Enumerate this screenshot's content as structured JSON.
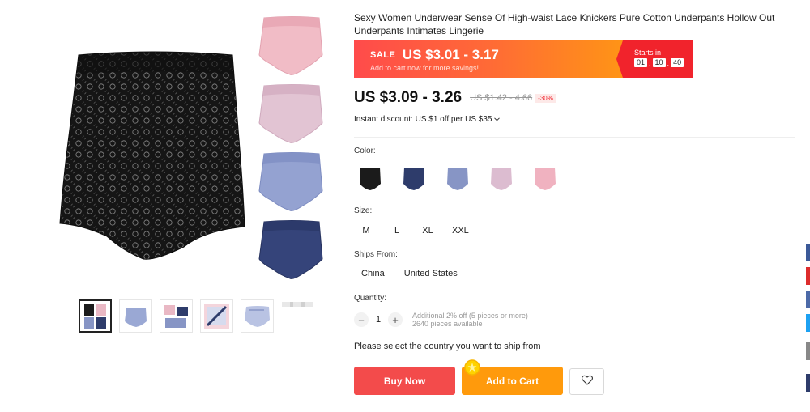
{
  "product": {
    "title": "Sexy Women Underwear Sense Of High-waist Lace Knickers Pure Cotton Underpants Hollow Out Underpants Intimates Lingerie"
  },
  "sale": {
    "label": "SALE",
    "price": "US $3.01 - 3.17",
    "subtitle": "Add to cart now for more savings!",
    "starts_label": "Starts in",
    "timer": [
      "01",
      "10",
      "40"
    ]
  },
  "price": {
    "current": "US $3.09 - 3.26",
    "original": "US $1.42 - 4.66",
    "discount": "-30%"
  },
  "instant_discount": "Instant discount: US $1 off per US $35",
  "color": {
    "label": "Color:",
    "swatches": [
      {
        "name": "black",
        "hex": "#1b1b1b"
      },
      {
        "name": "navy",
        "hex": "#2e3c6b"
      },
      {
        "name": "light-blue",
        "hex": "#8795c5"
      },
      {
        "name": "light-pink",
        "hex": "#dcbcd0"
      },
      {
        "name": "pink",
        "hex": "#f0b2c0"
      }
    ]
  },
  "size": {
    "label": "Size:",
    "options": [
      "M",
      "L",
      "XL",
      "XXL"
    ]
  },
  "ships_from": {
    "label": "Ships From:",
    "options": [
      "China",
      "United States"
    ]
  },
  "quantity": {
    "label": "Quantity:",
    "value": "1",
    "minus": "−",
    "plus": "+",
    "note_discount": "Additional 2% off (5 pieces or more)",
    "note_available": "2640 pieces available"
  },
  "ship_message": "Please select the country you want to ship from",
  "buttons": {
    "buy_now": "Buy Now",
    "add_to_cart": "Add to Cart"
  },
  "colors": {
    "sale_red": "#f1232c",
    "buy_red": "#f34b4b",
    "cart_orange": "#ff9a0c"
  }
}
